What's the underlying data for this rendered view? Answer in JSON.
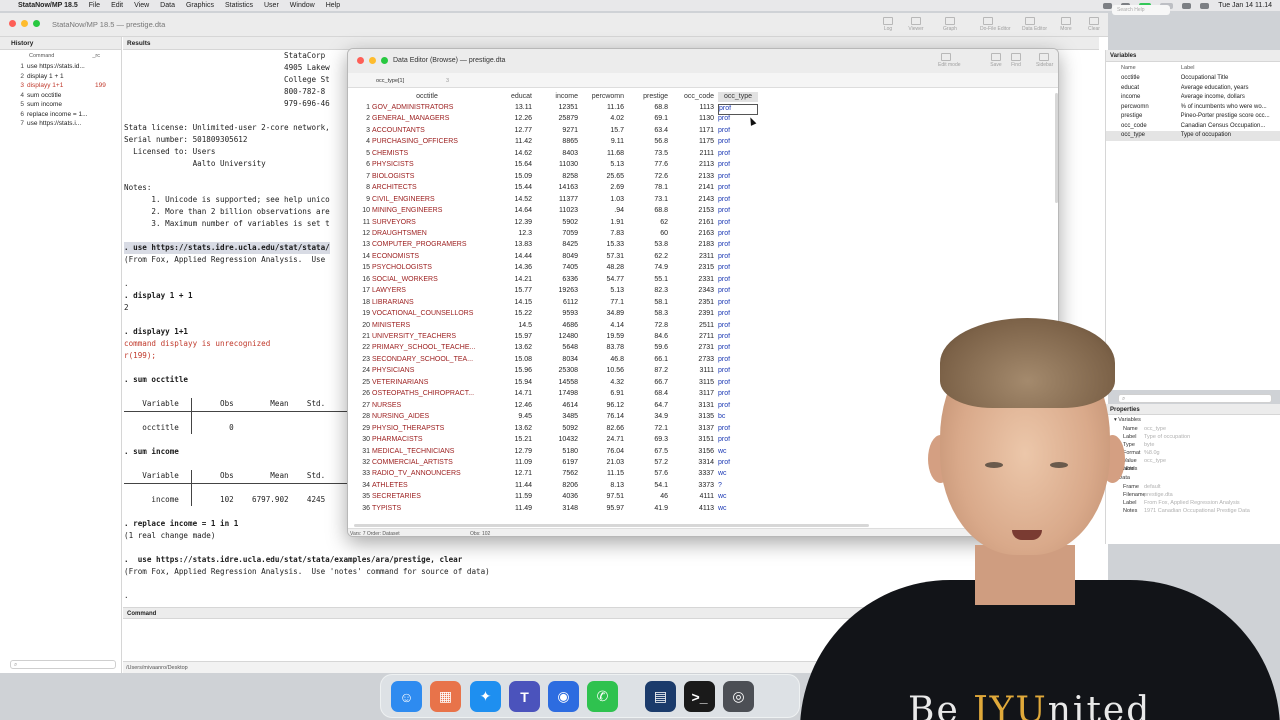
{
  "menubar": {
    "app": "StataNow/MP 18.5",
    "items": [
      "File",
      "Edit",
      "View",
      "Data",
      "Graphics",
      "Statistics",
      "User",
      "Window",
      "Help"
    ],
    "clock": "Tue Jan 14  11.14"
  },
  "stata": {
    "title": "StataNow/MP 18.5 — prestige.dta",
    "toolbar": [
      "Log",
      "Viewer",
      "Graph",
      "Do-File Editor",
      "Data Editor",
      "More",
      "Clear",
      "Search"
    ],
    "search_placeholder": "Search Help"
  },
  "history": {
    "header": "History",
    "col_command": "Command",
    "col_rc": "_rc",
    "rows": [
      {
        "num": "1",
        "cmd": "use https://stats.id...",
        "rc": ""
      },
      {
        "num": "2",
        "cmd": "display 1 + 1",
        "rc": ""
      },
      {
        "num": "3",
        "cmd": "displayy 1+1",
        "rc": "199"
      },
      {
        "num": "4",
        "cmd": "sum occtitle",
        "rc": ""
      },
      {
        "num": "5",
        "cmd": "sum income",
        "rc": ""
      },
      {
        "num": "6",
        "cmd": "replace income = 1...",
        "rc": ""
      },
      {
        "num": "7",
        "cmd": "use https://stats.i...",
        "rc": ""
      }
    ]
  },
  "results": {
    "header": "Results",
    "lines": [
      "                                   StataCorp",
      "                                   4905 Lakew",
      "                                   College St",
      "                                   800-782-8",
      "                                   979-696-46",
      "",
      "Stata license: Unlimited-user 2-core network,",
      "Serial number: 501809305612",
      "  Licensed to: Users",
      "               Aalto University",
      "",
      "Notes:",
      "      1. Unicode is supported; see help unico",
      "      2. More than 2 billion observations are",
      "      3. Maximum number of variables is set t",
      "",
      ". use https://stats.idre.ucla.edu/stat/stata/",
      "(From Fox, Applied Regression Analysis.  Use",
      "",
      ".",
      ". display 1 + 1",
      "2",
      "",
      ". displayy 1+1",
      "command displayy is unrecognized",
      "r(199);",
      "",
      ". sum occtitle",
      "",
      "    Variable         Obs        Mean    Std.",
      "",
      "    occtitle           0",
      "",
      ". sum income",
      "",
      "    Variable         Obs        Mean    Std.",
      "",
      "      income         102    6797.902    4245",
      "",
      ". replace income = 1 in 1",
      "(1 real change made)",
      "",
      ".  use https://stats.idre.ucla.edu/stat/stata/examples/ara/prestige, clear",
      "(From Fox, Applied Regression Analysis.  Use 'notes' command for source of data)",
      "",
      "."
    ]
  },
  "command_panel": {
    "header": "Command"
  },
  "status_path": "/Users/mivaanro/Desktop",
  "variables": {
    "header": "Variables",
    "col_name": "Name",
    "col_label": "Label",
    "rows": [
      {
        "name": "occtitle",
        "label": "Occupational Title"
      },
      {
        "name": "educat",
        "label": "Average education, years"
      },
      {
        "name": "income",
        "label": "Average income, dollars"
      },
      {
        "name": "percwomn",
        "label": "% of incumbents who were wo..."
      },
      {
        "name": "prestige",
        "label": "Pineo-Porter prestige score occ..."
      },
      {
        "name": "occ_code",
        "label": "Canadian Census Occupation..."
      },
      {
        "name": "occ_type",
        "label": "Type of occupation"
      }
    ]
  },
  "properties": {
    "header": "Properties",
    "sections": {
      "variables": "Variables",
      "data": "Data"
    },
    "variable_rows": [
      {
        "k": "Name",
        "v": "occ_type"
      },
      {
        "k": "Label",
        "v": "Type of occupation"
      },
      {
        "k": "Type",
        "v": "byte"
      },
      {
        "k": "Format",
        "v": "%8.0g"
      },
      {
        "k": "Value label",
        "v": "occ_type"
      },
      {
        "k": "Notes",
        "v": ""
      }
    ],
    "data_rows": [
      {
        "k": "Frame",
        "v": "default"
      },
      {
        "k": "Filename",
        "v": "prestige.dta"
      },
      {
        "k": "Label",
        "v": "From Fox, Applied Regression Analysis"
      },
      {
        "k": "Notes",
        "v": "1971 Canadian Occupational Prestige Data"
      }
    ]
  },
  "data_editor": {
    "title": "Data Editor (Browse) — prestige.dta",
    "cell_ref": "occ_type[1]",
    "cell_value": "3",
    "toolbar": [
      "Edit mode",
      "Save",
      "Find",
      "Sidebar"
    ],
    "columns": [
      "occtitle",
      "educat",
      "income",
      "percwomn",
      "prestige",
      "occ_code",
      "occ_type"
    ],
    "rows": [
      [
        "1",
        "GOV_ADMINISTRATORS",
        "13.11",
        "12351",
        "11.16",
        "68.8",
        "1113",
        "prof"
      ],
      [
        "2",
        "GENERAL_MANAGERS",
        "12.26",
        "25879",
        "4.02",
        "69.1",
        "1130",
        "prof"
      ],
      [
        "3",
        "ACCOUNTANTS",
        "12.77",
        "9271",
        "15.7",
        "63.4",
        "1171",
        "prof"
      ],
      [
        "4",
        "PURCHASING_OFFICERS",
        "11.42",
        "8865",
        "9.11",
        "56.8",
        "1175",
        "prof"
      ],
      [
        "5",
        "CHEMISTS",
        "14.62",
        "8403",
        "11.68",
        "73.5",
        "2111",
        "prof"
      ],
      [
        "6",
        "PHYSICISTS",
        "15.64",
        "11030",
        "5.13",
        "77.6",
        "2113",
        "prof"
      ],
      [
        "7",
        "BIOLOGISTS",
        "15.09",
        "8258",
        "25.65",
        "72.6",
        "2133",
        "prof"
      ],
      [
        "8",
        "ARCHITECTS",
        "15.44",
        "14163",
        "2.69",
        "78.1",
        "2141",
        "prof"
      ],
      [
        "9",
        "CIVIL_ENGINEERS",
        "14.52",
        "11377",
        "1.03",
        "73.1",
        "2143",
        "prof"
      ],
      [
        "10",
        "MINING_ENGINEERS",
        "14.64",
        "11023",
        ".94",
        "68.8",
        "2153",
        "prof"
      ],
      [
        "11",
        "SURVEYORS",
        "12.39",
        "5902",
        "1.91",
        "62",
        "2161",
        "prof"
      ],
      [
        "12",
        "DRAUGHTSMEN",
        "12.3",
        "7059",
        "7.83",
        "60",
        "2163",
        "prof"
      ],
      [
        "13",
        "COMPUTER_PROGRAMERS",
        "13.83",
        "8425",
        "15.33",
        "53.8",
        "2183",
        "prof"
      ],
      [
        "14",
        "ECONOMISTS",
        "14.44",
        "8049",
        "57.31",
        "62.2",
        "2311",
        "prof"
      ],
      [
        "15",
        "PSYCHOLOGISTS",
        "14.36",
        "7405",
        "48.28",
        "74.9",
        "2315",
        "prof"
      ],
      [
        "16",
        "SOCIAL_WORKERS",
        "14.21",
        "6336",
        "54.77",
        "55.1",
        "2331",
        "prof"
      ],
      [
        "17",
        "LAWYERS",
        "15.77",
        "19263",
        "5.13",
        "82.3",
        "2343",
        "prof"
      ],
      [
        "18",
        "LIBRARIANS",
        "14.15",
        "6112",
        "77.1",
        "58.1",
        "2351",
        "prof"
      ],
      [
        "19",
        "VOCATIONAL_COUNSELLORS",
        "15.22",
        "9593",
        "34.89",
        "58.3",
        "2391",
        "prof"
      ],
      [
        "20",
        "MINISTERS",
        "14.5",
        "4686",
        "4.14",
        "72.8",
        "2511",
        "prof"
      ],
      [
        "21",
        "UNIVERSITY_TEACHERS",
        "15.97",
        "12480",
        "19.59",
        "84.6",
        "2711",
        "prof"
      ],
      [
        "22",
        "PRIMARY_SCHOOL_TEACHE...",
        "13.62",
        "5648",
        "83.78",
        "59.6",
        "2731",
        "prof"
      ],
      [
        "23",
        "SECONDARY_SCHOOL_TEA...",
        "15.08",
        "8034",
        "46.8",
        "66.1",
        "2733",
        "prof"
      ],
      [
        "24",
        "PHYSICIANS",
        "15.96",
        "25308",
        "10.56",
        "87.2",
        "3111",
        "prof"
      ],
      [
        "25",
        "VETERINARIANS",
        "15.94",
        "14558",
        "4.32",
        "66.7",
        "3115",
        "prof"
      ],
      [
        "26",
        "OSTEOPATHS_CHIROPRACT...",
        "14.71",
        "17498",
        "6.91",
        "68.4",
        "3117",
        "prof"
      ],
      [
        "27",
        "NURSES",
        "12.46",
        "4614",
        "96.12",
        "64.7",
        "3131",
        "prof"
      ],
      [
        "28",
        "NURSING_AIDES",
        "9.45",
        "3485",
        "76.14",
        "34.9",
        "3135",
        "bc"
      ],
      [
        "29",
        "PHYSIO_THERAPSTS",
        "13.62",
        "5092",
        "82.66",
        "72.1",
        "3137",
        "prof"
      ],
      [
        "30",
        "PHARMACISTS",
        "15.21",
        "10432",
        "24.71",
        "69.3",
        "3151",
        "prof"
      ],
      [
        "31",
        "MEDICAL_TECHNICIANS",
        "12.79",
        "5180",
        "76.04",
        "67.5",
        "3156",
        "wc"
      ],
      [
        "32",
        "COMMERCIAL_ARTISTS",
        "11.09",
        "6197",
        "21.03",
        "57.2",
        "3314",
        "prof"
      ],
      [
        "33",
        "RADIO_TV_ANNOUNCERS",
        "12.71",
        "7562",
        "11.15",
        "57.6",
        "3337",
        "wc"
      ],
      [
        "34",
        "ATHLETES",
        "11.44",
        "8206",
        "8.13",
        "54.1",
        "3373",
        "?"
      ],
      [
        "35",
        "SECRETARIES",
        "11.59",
        "4036",
        "97.51",
        "46",
        "4111",
        "wc"
      ],
      [
        "36",
        "TYPISTS",
        "11.49",
        "3148",
        "95.97",
        "41.9",
        "4113",
        "wc"
      ]
    ],
    "status_left": "Vars: 7  Order: Dataset",
    "status_right": "Obs: 102"
  },
  "dock": {
    "apps": [
      "finder-icon",
      "launchpad-icon",
      "safari-icon",
      "teams-icon",
      "zoom-icon",
      "whatsapp-icon",
      "stata-icon",
      "terminal-icon",
      "screenshot-icon"
    ]
  },
  "webcam": {
    "shirt_text_a": "Be ",
    "shirt_text_b": "JYU",
    "shirt_text_c": "nited"
  }
}
